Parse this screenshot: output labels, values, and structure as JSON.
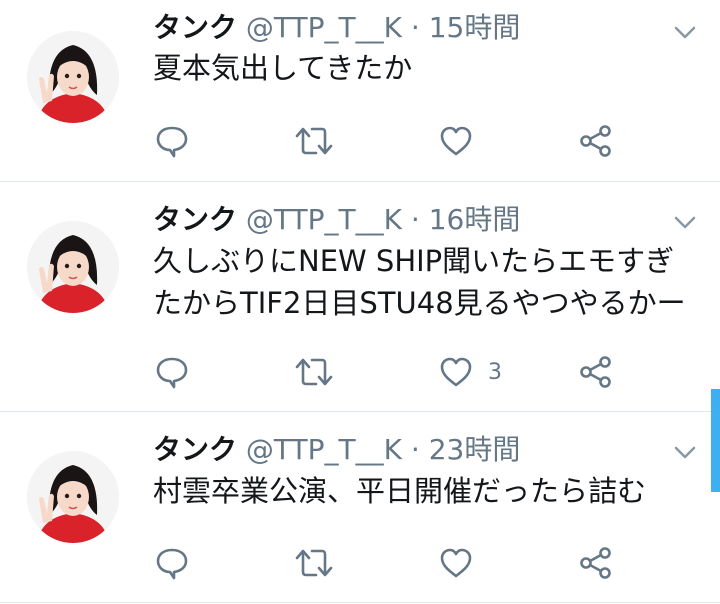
{
  "tweets": [
    {
      "name": "タンク",
      "handle": "@TTP_T__K",
      "separator": "·",
      "time": "15時間",
      "lines": [
        "夏本気出してきたか"
      ],
      "like_count": ""
    },
    {
      "name": "タンク",
      "handle": "@TTP_T__K",
      "separator": "·",
      "time": "16時間",
      "lines": [
        "久しぶりにNEW SHIP聞いたらエモすぎ",
        "たからTIF2日目STU48見るやつやるかー"
      ],
      "like_count": "3"
    },
    {
      "name": "タンク",
      "handle": "@TTP_T__K",
      "separator": "·",
      "time": "23時間",
      "lines": [
        "村雲卒業公演、平日開催だったら詰む"
      ],
      "like_count": ""
    }
  ],
  "icons": [
    "reply-icon",
    "retweet-icon",
    "like-icon",
    "share-icon",
    "chevron-down-icon"
  ],
  "colors": {
    "icon": "#657786",
    "accent": "#1da1f2",
    "divider": "#e1e8ed"
  }
}
